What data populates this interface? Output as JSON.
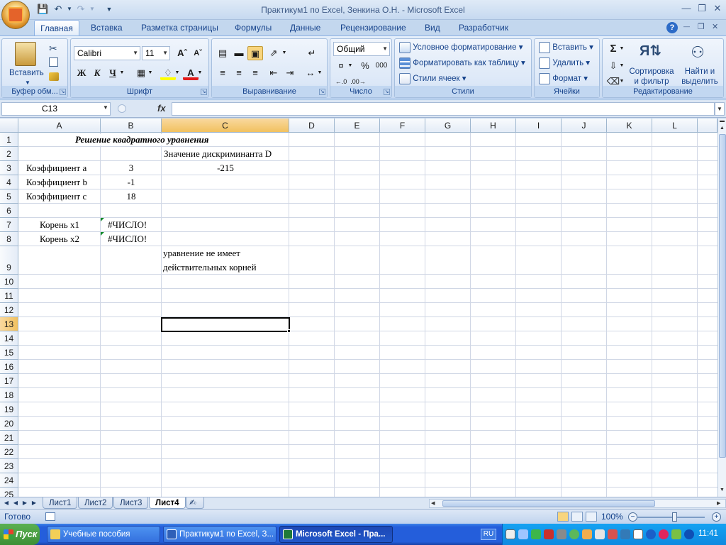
{
  "window": {
    "title": "Практикум1 по Excel, Зенкина О.Н. - Microsoft Excel"
  },
  "ribbon": {
    "tabs": [
      "Главная",
      "Вставка",
      "Разметка страницы",
      "Формулы",
      "Данные",
      "Рецензирование",
      "Вид",
      "Разработчик"
    ],
    "active_tab": "Главная",
    "clipboard": {
      "paste_label": "Вставить",
      "group_label": "Буфер обм..."
    },
    "font": {
      "name": "Calibri",
      "size": "11",
      "bold": "Ж",
      "italic": "К",
      "underline": "Ч",
      "group_label": "Шрифт"
    },
    "alignment": {
      "group_label": "Выравнивание"
    },
    "number": {
      "format": "Общий",
      "percent": "%",
      "thousands": "000",
      "group_label": "Число"
    },
    "styles": {
      "conditional": "Условное форматирование",
      "as_table": "Форматировать как таблицу",
      "cell_styles": "Стили ячеек",
      "group_label": "Стили"
    },
    "cells": {
      "insert": "Вставить",
      "delete": "Удалить",
      "format": "Формат",
      "group_label": "Ячейки"
    },
    "editing": {
      "sum": "Σ",
      "sort_line1": "Сортировка",
      "sort_line2": "и фильтр",
      "find_line1": "Найти и",
      "find_line2": "выделить",
      "group_label": "Редактирование"
    }
  },
  "formula_bar": {
    "name_box": "C13",
    "fx": "fx",
    "formula": ""
  },
  "grid": {
    "columns": [
      "A",
      "B",
      "C",
      "D",
      "E",
      "F",
      "G",
      "H",
      "I",
      "J",
      "K",
      "L"
    ],
    "rows": [
      "1",
      "2",
      "3",
      "4",
      "5",
      "6",
      "7",
      "8",
      "9",
      "10",
      "11",
      "12",
      "13",
      "14",
      "15",
      "16",
      "17",
      "18",
      "19",
      "20",
      "21",
      "22",
      "23",
      "24",
      "25"
    ],
    "selected_cell": "C13",
    "cells": {
      "A1": "Решение квадратного уравнения",
      "C2": "Значение дискриминанта D",
      "A3": "Коэффициент a",
      "B3": "3",
      "C3": "-215",
      "A4": "Коэффициент b",
      "B4": "-1",
      "A5": "Коэффициент c",
      "B5": "18",
      "A7": "Корень x1",
      "B7": "#ЧИСЛО!",
      "A8": "Корень x2",
      "B8": "#ЧИСЛО!",
      "C9_line1": "уравнение не имеет",
      "C9_line2": "действительных корней"
    }
  },
  "sheets": {
    "tabs": [
      "Лист1",
      "Лист2",
      "Лист3",
      "Лист4"
    ],
    "active": "Лист4"
  },
  "status": {
    "text": "Готово",
    "zoom": "100%"
  },
  "taskbar": {
    "start": "Пуск",
    "items": [
      "Учебные пособия",
      "Практикум1 по Excel, З...",
      "Microsoft Excel - Пра..."
    ],
    "lang": "RU",
    "clock": "11:41"
  }
}
